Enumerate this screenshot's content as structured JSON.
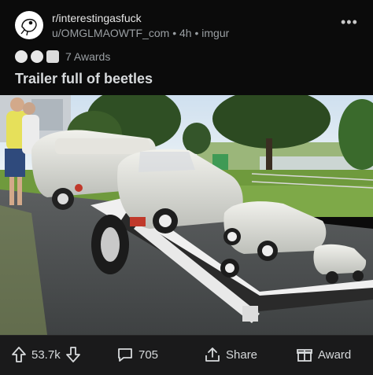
{
  "post": {
    "subreddit": "r/interestingasfuck",
    "meta": "u/OMGLMAOWTF_com • 4h • imgur",
    "more": "•••",
    "awards_label": "7 Awards",
    "title": "Trailer full of beetles"
  },
  "actions": {
    "score": "53.7k",
    "comments": "705",
    "share": "Share",
    "award": "Award"
  },
  "icons": {
    "upvote": "upvote-arrow-icon",
    "downvote": "downvote-arrow-icon",
    "comment": "comment-bubble-icon",
    "share": "share-icon",
    "award": "gift-award-icon"
  }
}
